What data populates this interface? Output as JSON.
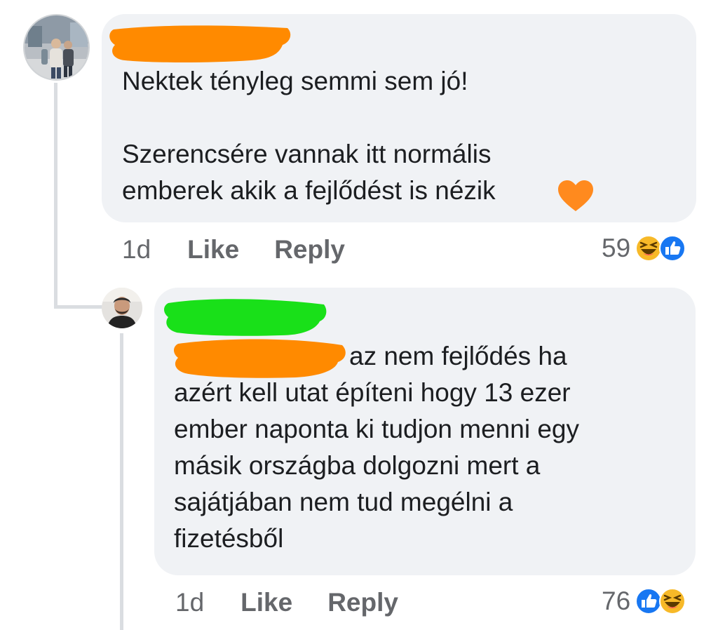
{
  "comments": [
    {
      "author_redacted": true,
      "text": "Nektek tényleg semmi sem jó!\n\nSzerencsére vannak itt normális\nemberek akik a fejlődést is nézik",
      "emoji": "orange-heart",
      "time": "1d",
      "like_label": "Like",
      "reply_label": "Reply",
      "reaction_count": "59",
      "reaction_icons": [
        "haha-icon",
        "like-icon"
      ]
    },
    {
      "author_redacted": true,
      "text": "az nem fejlődés ha\nazért kell utat építeni hogy 13 ezer\nember naponta ki tudjon menni egy\nmásik országba dolgozni mert a\nsajátjában nem tud megélni a\nfizetésből",
      "time": "1d",
      "like_label": "Like",
      "reply_label": "Reply",
      "reaction_count": "76",
      "reaction_icons": [
        "like-icon",
        "haha-icon"
      ]
    }
  ],
  "colors": {
    "bubble": "#f0f2f5",
    "redact_orange": "#ff8a00",
    "redact_green": "#19e019",
    "like_blue": "#1877f2",
    "haha_yellow": "#f7b928",
    "meta_gray": "#65676b"
  }
}
